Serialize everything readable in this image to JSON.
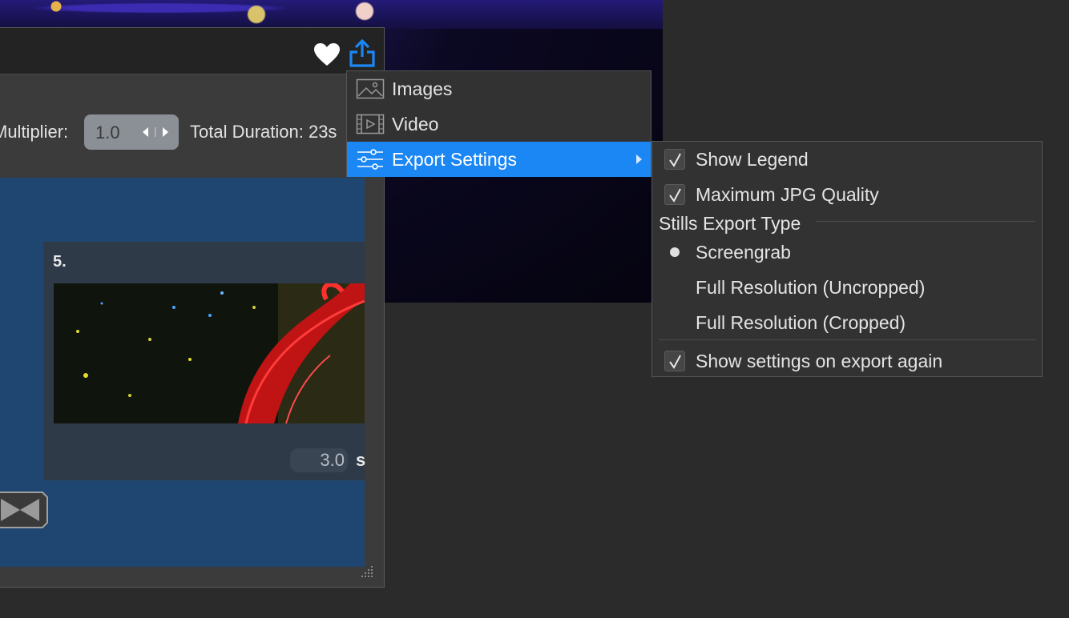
{
  "panel": {
    "multiplier_label": "Multiplier:",
    "multiplier_value": "1.0",
    "total_duration": "Total Duration: 23s"
  },
  "clip": {
    "number": "5.",
    "duration_value": "3.0",
    "duration_unit": "s"
  },
  "export_menu": {
    "items": [
      {
        "label": "Images",
        "icon": "image-icon"
      },
      {
        "label": "Video",
        "icon": "video-icon"
      },
      {
        "label": "Export Settings",
        "icon": "sliders-icon"
      }
    ]
  },
  "export_settings": {
    "show_legend": {
      "label": "Show Legend",
      "checked": true
    },
    "max_jpg_quality": {
      "label": "Maximum JPG Quality",
      "checked": true
    },
    "stills_export_type_title": "Stills Export Type",
    "stills_options": [
      {
        "label": "Screengrab",
        "selected": true
      },
      {
        "label": "Full Resolution (Uncropped)",
        "selected": false
      },
      {
        "label": "Full Resolution (Cropped)",
        "selected": false
      }
    ],
    "show_settings_again": {
      "label": "Show settings on export again",
      "checked": true
    }
  },
  "colors": {
    "accent": "#1b87f5",
    "timeline_bg": "#1f4670",
    "menu_bg": "#323232"
  }
}
